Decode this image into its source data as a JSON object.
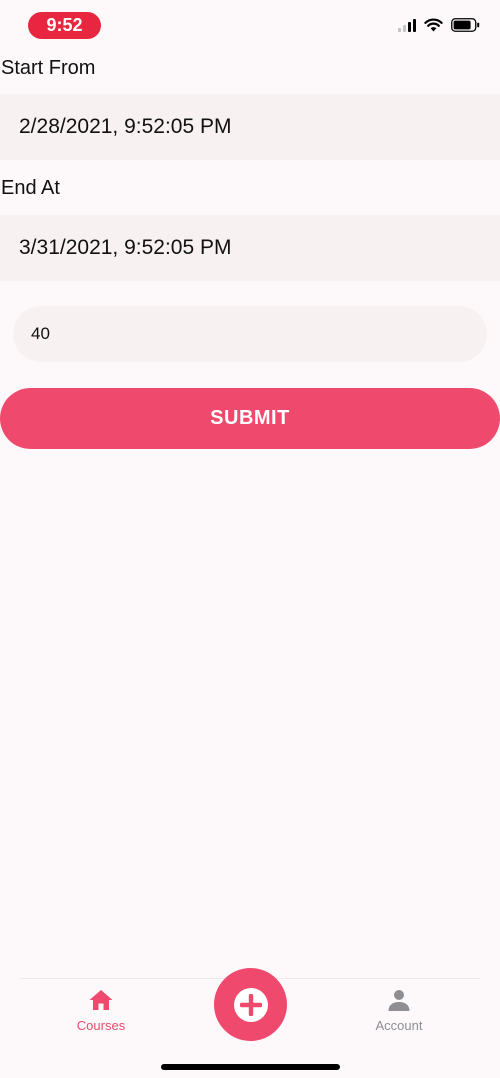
{
  "status_bar": {
    "time": "9:52",
    "icons": [
      "cellular-signal-icon",
      "wifi-icon",
      "battery-icon"
    ]
  },
  "form": {
    "start_label": "Start From",
    "start_value": "2/28/2021, 9:52:05 PM",
    "end_label": "End At",
    "end_value": "3/31/2021, 9:52:05 PM",
    "number_value": "40",
    "submit_label": "SUBMIT"
  },
  "tab_bar": {
    "courses_label": "Courses",
    "account_label": "Account",
    "add_icon": "plus-icon",
    "courses_icon": "home-icon",
    "account_icon": "person-icon"
  },
  "colors": {
    "accent": "#ef4a6d",
    "time_pill": "#e8263f",
    "field_bg": "#f7f1f2",
    "background": "#fdf9fb",
    "inactive_tab": "#8e8e93"
  }
}
